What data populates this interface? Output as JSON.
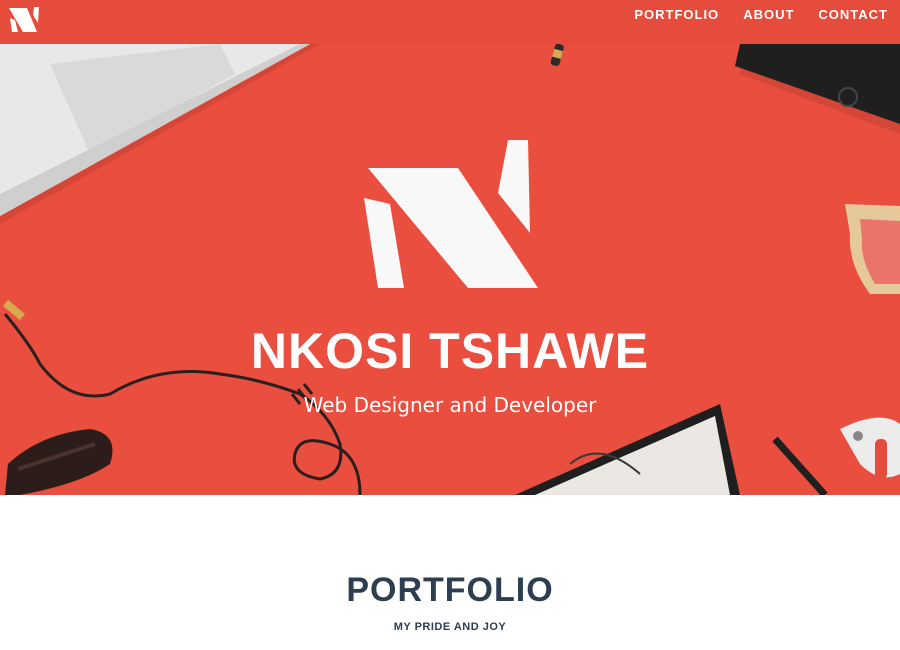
{
  "colors": {
    "brand_red": "#e64c3c",
    "hero_red": "#e94e3f",
    "heading_navy": "#2c3e50"
  },
  "nav": {
    "logo_icon": "n-monogram-logo-icon",
    "links": [
      {
        "label": "PORTFOLIO"
      },
      {
        "label": "ABOUT"
      },
      {
        "label": "CONTACT"
      }
    ]
  },
  "hero": {
    "logo_icon": "n-monogram-logo-icon",
    "name": "NKOSI TSHAWE",
    "tagline": "Web Designer and Developer"
  },
  "portfolio": {
    "heading": "PORTFOLIO",
    "subheading": "MY PRIDE AND JOY"
  }
}
